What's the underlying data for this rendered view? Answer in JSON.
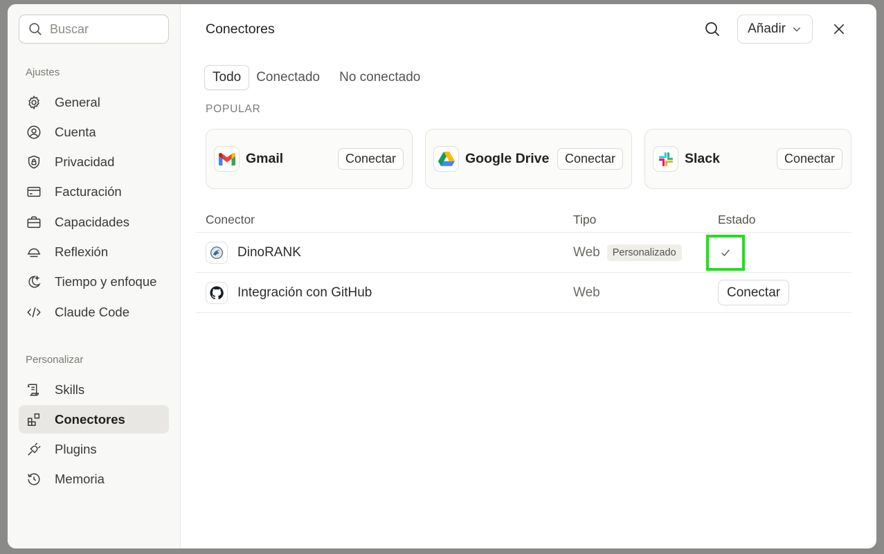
{
  "sidebar": {
    "search_placeholder": "Buscar",
    "settings_label": "Ajustes",
    "settings_items": [
      {
        "label": "General",
        "icon": "gear-icon"
      },
      {
        "label": "Cuenta",
        "icon": "user-circle-icon"
      },
      {
        "label": "Privacidad",
        "icon": "shield-lock-icon"
      },
      {
        "label": "Facturación",
        "icon": "credit-card-icon"
      },
      {
        "label": "Capacidades",
        "icon": "briefcase-icon"
      },
      {
        "label": "Reflexión",
        "icon": "sunrise-icon"
      },
      {
        "label": "Tiempo y enfoque",
        "icon": "moon-stars-icon"
      },
      {
        "label": "Claude Code",
        "icon": "code-icon"
      }
    ],
    "customize_label": "Personalizar",
    "customize_items": [
      {
        "label": "Skills",
        "icon": "scroll-icon"
      },
      {
        "label": "Conectores",
        "icon": "blocks-icon",
        "active": true
      },
      {
        "label": "Plugins",
        "icon": "plug-icon"
      },
      {
        "label": "Memoria",
        "icon": "history-icon"
      }
    ]
  },
  "header": {
    "title": "Conectores",
    "add_label": "Añadir"
  },
  "tabs": [
    {
      "label": "Todo",
      "active": true
    },
    {
      "label": "Conectado"
    },
    {
      "label": "No conectado"
    }
  ],
  "popular": {
    "label": "POPULAR",
    "cards": [
      {
        "name": "Gmail",
        "button": "Conectar",
        "icon": "gmail-icon"
      },
      {
        "name": "Google Drive",
        "button": "Conectar",
        "icon": "google-drive-icon"
      },
      {
        "name": "Slack",
        "button": "Conectar",
        "icon": "slack-icon"
      }
    ]
  },
  "table": {
    "headers": [
      "Conector",
      "Tipo",
      "Estado"
    ],
    "rows": [
      {
        "name": "DinoRANK",
        "type": "Web",
        "badge": "Personalizado",
        "state": "connected",
        "icon": "dinorank-icon"
      },
      {
        "name": "Integración con GitHub",
        "type": "Web",
        "button": "Conectar",
        "icon": "github-icon"
      }
    ]
  },
  "colors": {
    "highlight": "#22e01b",
    "active_nav": "#e8e7e3"
  }
}
